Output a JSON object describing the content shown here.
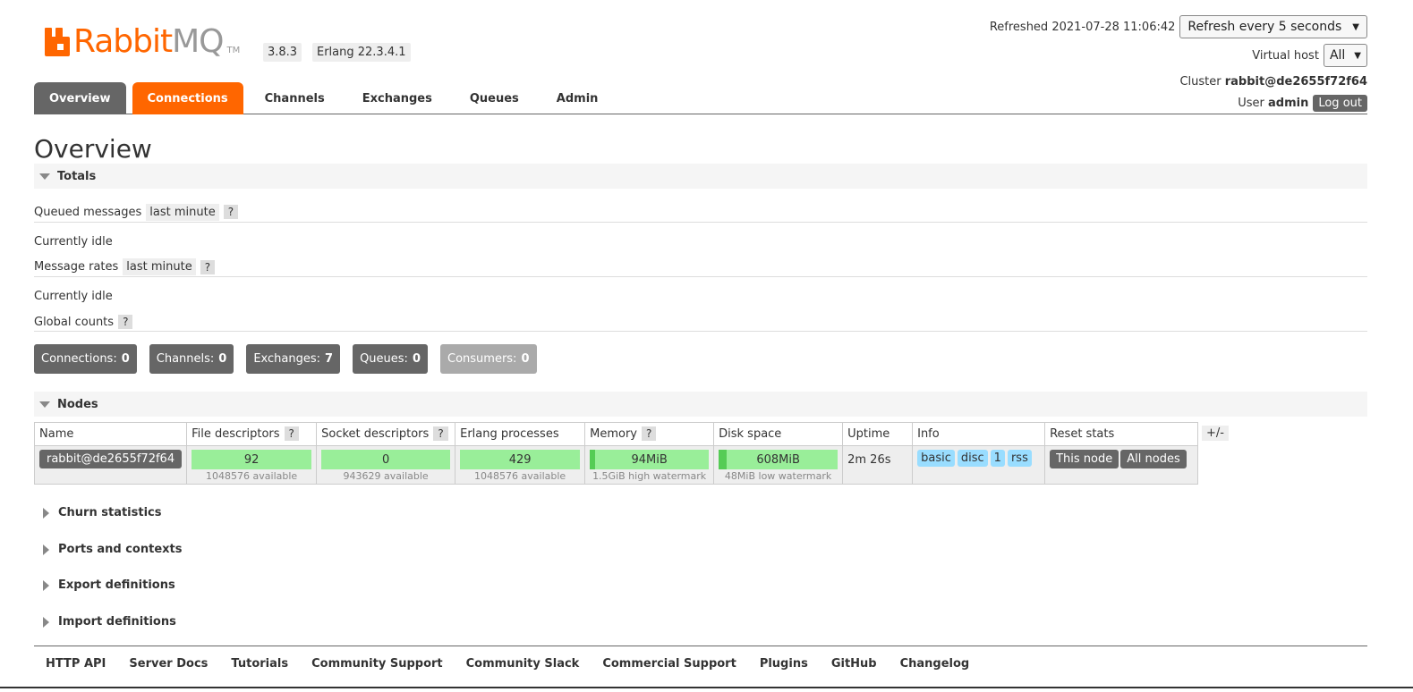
{
  "logo": {
    "part1": "Rabbit",
    "part2": "MQ",
    "tm": "TM"
  },
  "versions": {
    "rabbitmq": "3.8.3",
    "erlang": "Erlang 22.3.4.1"
  },
  "header": {
    "refreshed": "Refreshed 2021-07-28 11:06:42",
    "refresh_select": "Refresh every 5 seconds",
    "vhost_label": "Virtual host",
    "vhost_select": "All",
    "cluster_label": "Cluster",
    "cluster_name": "rabbit@de2655f72f64",
    "user_label": "User",
    "user_name": "admin",
    "logout": "Log out"
  },
  "tabs": [
    "Overview",
    "Connections",
    "Channels",
    "Exchanges",
    "Queues",
    "Admin"
  ],
  "page_title": "Overview",
  "totals": {
    "title": "Totals",
    "queued_label": "Queued messages",
    "queued_range": "last minute",
    "help": "?",
    "idle1": "Currently idle",
    "rates_label": "Message rates",
    "rates_range": "last minute",
    "idle2": "Currently idle",
    "global_label": "Global counts",
    "counts": [
      {
        "label": "Connections:",
        "value": "0"
      },
      {
        "label": "Channels:",
        "value": "0"
      },
      {
        "label": "Exchanges:",
        "value": "7"
      },
      {
        "label": "Queues:",
        "value": "0"
      },
      {
        "label": "Consumers:",
        "value": "0"
      }
    ]
  },
  "nodes": {
    "title": "Nodes",
    "headers": [
      "Name",
      "File descriptors",
      "Socket descriptors",
      "Erlang processes",
      "Memory",
      "Disk space",
      "Uptime",
      "Info",
      "Reset stats"
    ],
    "plusminus": "+/-",
    "row": {
      "name": "rabbit@de2655f72f64",
      "fd_value": "92",
      "fd_sub": "1048576 available",
      "sd_value": "0",
      "sd_sub": "943629 available",
      "ep_value": "429",
      "ep_sub": "1048576 available",
      "mem_value": "94MiB",
      "mem_sub": "1.5GiB high watermark",
      "disk_value": "608MiB",
      "disk_sub": "48MiB low watermark",
      "uptime": "2m 26s",
      "info": [
        "basic",
        "disc",
        "1",
        "rss"
      ],
      "reset_this": "This node",
      "reset_all": "All nodes"
    }
  },
  "collapsed_sections": [
    "Churn statistics",
    "Ports and contexts",
    "Export definitions",
    "Import definitions"
  ],
  "footer": [
    "HTTP API",
    "Server Docs",
    "Tutorials",
    "Community Support",
    "Community Slack",
    "Commercial Support",
    "Plugins",
    "GitHub",
    "Changelog"
  ],
  "colors": {
    "brand": "#ff6600",
    "dark": "#666666",
    "meter": "#99ee99",
    "info": "#99ddff"
  }
}
